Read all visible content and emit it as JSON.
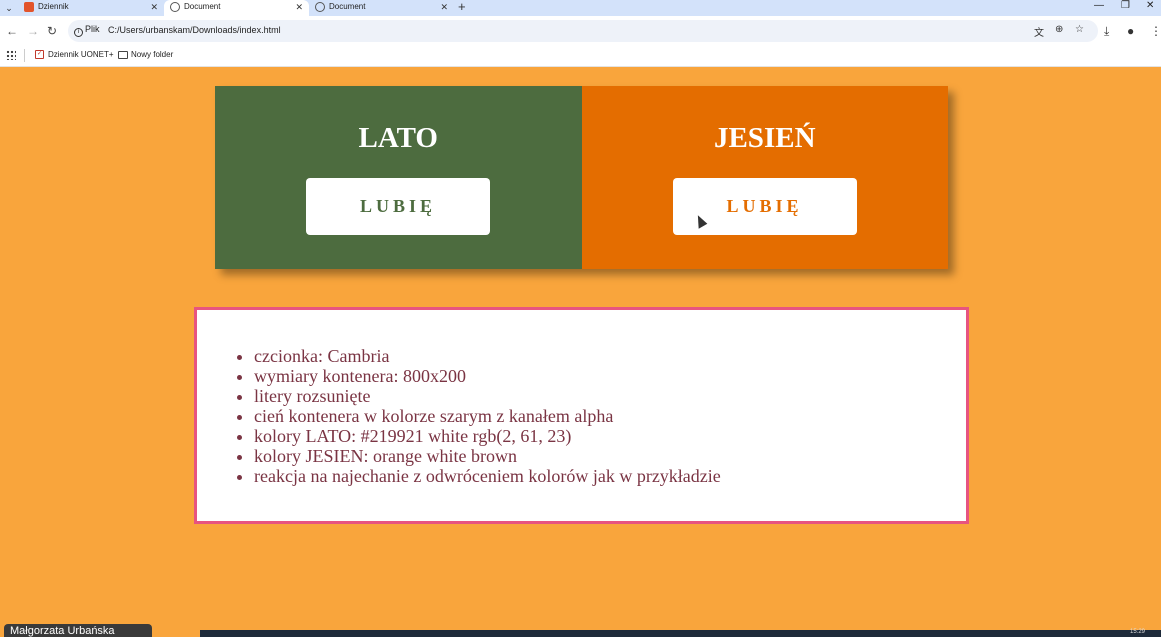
{
  "browser": {
    "tabs": [
      {
        "title": "Dziennik",
        "icon": "dziennik-favicon",
        "active": false
      },
      {
        "title": "Document",
        "icon": "globe-icon",
        "active": true
      },
      {
        "title": "Document",
        "icon": "globe-icon",
        "active": false
      }
    ],
    "site_info_label": "Plik",
    "url": "C:/Users/urbanskam/Downloads/index.html"
  },
  "bookmarks": [
    {
      "label": "Dziennik UONET+",
      "icon": "uonet-icon"
    },
    {
      "label": "Nowy folder",
      "icon": "folder-icon"
    }
  ],
  "page": {
    "lato": {
      "title": "LATO",
      "button": "LUBIĘ",
      "color": "#4d6c3f"
    },
    "jesien": {
      "title": "JESIEŃ",
      "button": "LUBIĘ",
      "color": "#e46d00"
    },
    "background": "#f9a53c",
    "notes": [
      "czcionka: Cambria",
      "wymiary kontenera: 800x200",
      "litery rozsunięte",
      "cień kontenera w kolorze szarym z kanałem alpha",
      "kolory LATO: #219921 white rgb(2, 61, 23)",
      "kolory JESIEN: orange white brown",
      "reakcja na najechanie z odwróceniem kolorów jak w przykładzie"
    ]
  },
  "presenter_name": "Małgorzata Urbańska",
  "clock": "15:29"
}
